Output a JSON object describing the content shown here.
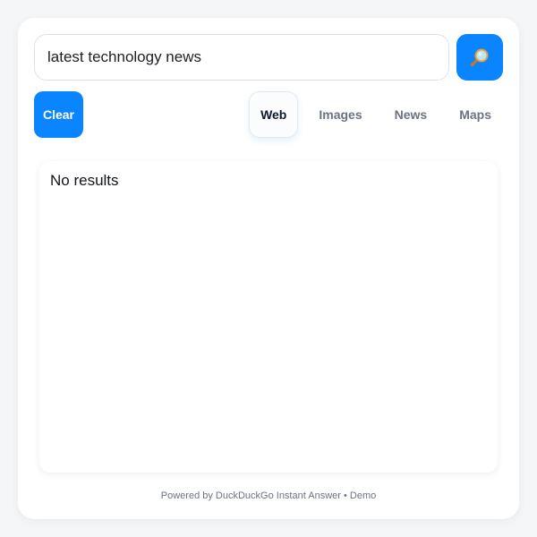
{
  "search": {
    "query": "latest technology news",
    "button_icon": "magnifier-icon"
  },
  "controls": {
    "clear_label": "Clear"
  },
  "tabs": [
    {
      "label": "Web",
      "active": true
    },
    {
      "label": "Images",
      "active": false
    },
    {
      "label": "News",
      "active": false
    },
    {
      "label": "Maps",
      "active": false
    }
  ],
  "results": {
    "message": "No results"
  },
  "footer": {
    "text": "Powered by DuckDuckGo Instant Answer • Demo"
  },
  "colors": {
    "accent": "#0a84ff",
    "background": "#f5f6f8",
    "card": "#ffffff",
    "muted_text": "#6b7480"
  }
}
